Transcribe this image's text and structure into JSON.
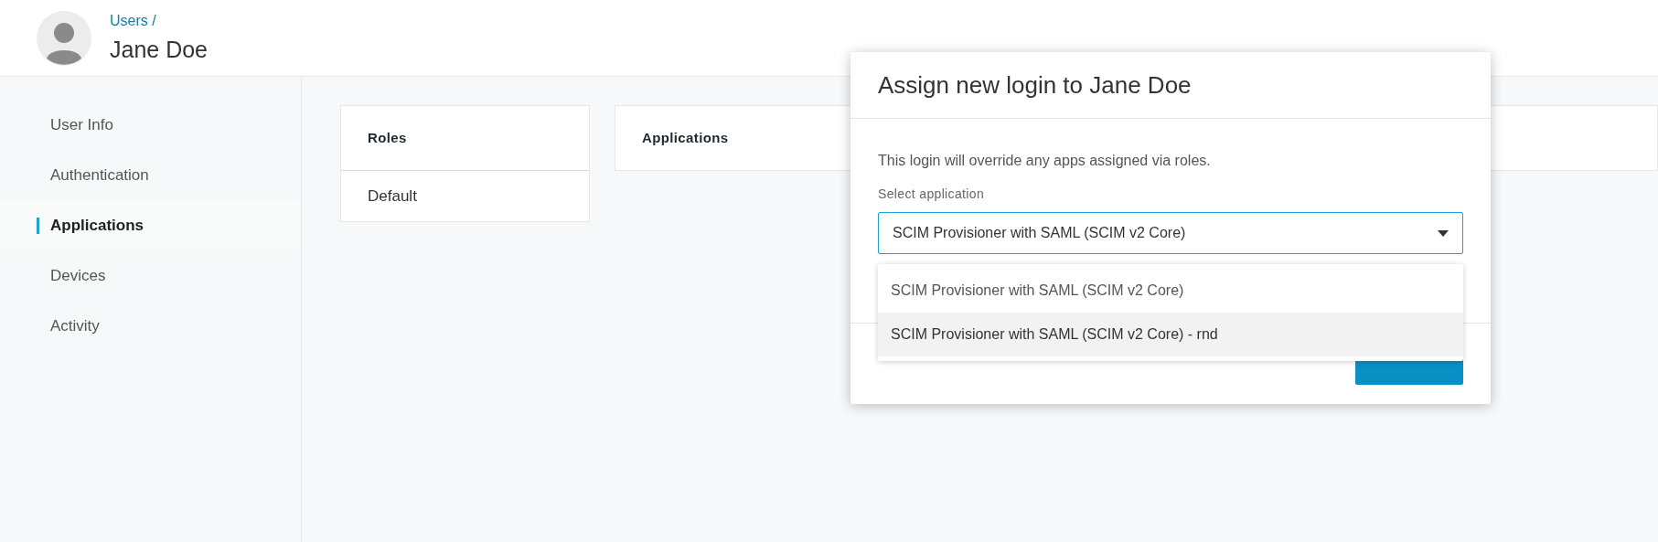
{
  "header": {
    "breadcrumb": "Users /",
    "title": "Jane Doe"
  },
  "sidebar": {
    "items": [
      {
        "label": "User Info",
        "selected": false
      },
      {
        "label": "Authentication",
        "selected": false
      },
      {
        "label": "Applications",
        "selected": true
      },
      {
        "label": "Devices",
        "selected": false
      },
      {
        "label": "Activity",
        "selected": false
      }
    ]
  },
  "roles_card": {
    "title": "Roles",
    "rows": [
      "Default"
    ]
  },
  "applications_card": {
    "title": "Applications"
  },
  "dialog": {
    "title": "Assign new login to Jane Doe",
    "description": "This login will override any apps assigned via roles.",
    "field_label": "Select application",
    "value": "SCIM Provisioner with SAML (SCIM v2 Core)",
    "options": [
      {
        "label": "SCIM Provisioner with SAML (SCIM v2 Core)",
        "highlighted": false
      },
      {
        "label": "SCIM Provisioner with SAML (SCIM v2 Core) - rnd",
        "highlighted": true
      }
    ]
  }
}
